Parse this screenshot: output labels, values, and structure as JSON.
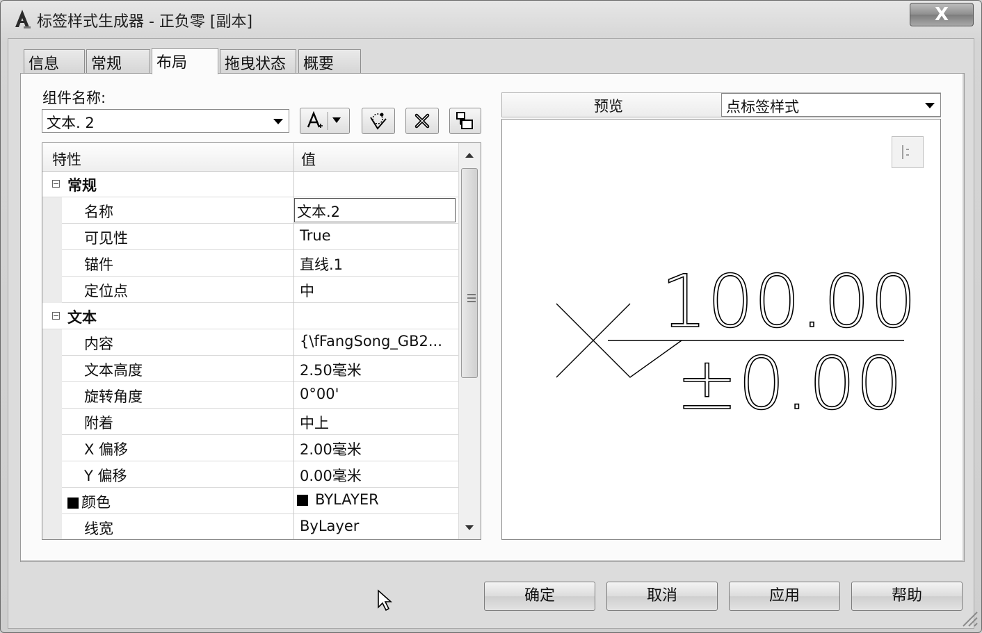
{
  "window": {
    "title": "标签样式生成器 - 正负零 [副本]",
    "close_label": "X"
  },
  "tabs": [
    {
      "label": "信息",
      "active": false
    },
    {
      "label": "常规",
      "active": false
    },
    {
      "label": "布局",
      "active": true
    },
    {
      "label": "拖曳状态",
      "active": false
    },
    {
      "label": "概要",
      "active": false
    }
  ],
  "component": {
    "label": "组件名称:",
    "value": "文本. 2"
  },
  "grid": {
    "header_property": "特性",
    "header_value": "值",
    "rows": [
      {
        "kind": "category",
        "name": "常规",
        "value": ""
      },
      {
        "kind": "prop",
        "name": "名称",
        "value": "文本.2",
        "selected": true
      },
      {
        "kind": "prop",
        "name": "可见性",
        "value": "True"
      },
      {
        "kind": "prop",
        "name": "锚件",
        "value": "直线.1"
      },
      {
        "kind": "prop",
        "name": "定位点",
        "value": "中"
      },
      {
        "kind": "category",
        "name": "文本",
        "value": ""
      },
      {
        "kind": "prop",
        "name": "内容",
        "value": "{\\fFangSong_GB2..."
      },
      {
        "kind": "prop",
        "name": "文本高度",
        "value": "2.50毫米"
      },
      {
        "kind": "prop",
        "name": "旋转角度",
        "value": "0°00'"
      },
      {
        "kind": "prop",
        "name": "附着",
        "value": "中上"
      },
      {
        "kind": "prop",
        "name": "X 偏移",
        "value": "2.00毫米"
      },
      {
        "kind": "prop",
        "name": "Y 偏移",
        "value": "0.00毫米"
      },
      {
        "kind": "prop",
        "name": "颜色",
        "value": "BYLAYER",
        "swatch": "#000000"
      },
      {
        "kind": "prop",
        "name": "线宽",
        "value": "ByLayer"
      }
    ]
  },
  "preview": {
    "label": "预览",
    "style_select": "点标签样式",
    "elevation_text": "100.00",
    "tolerance_text": "±0.00"
  },
  "buttons": {
    "ok": "确定",
    "cancel": "取消",
    "apply": "应用",
    "help": "帮助"
  }
}
